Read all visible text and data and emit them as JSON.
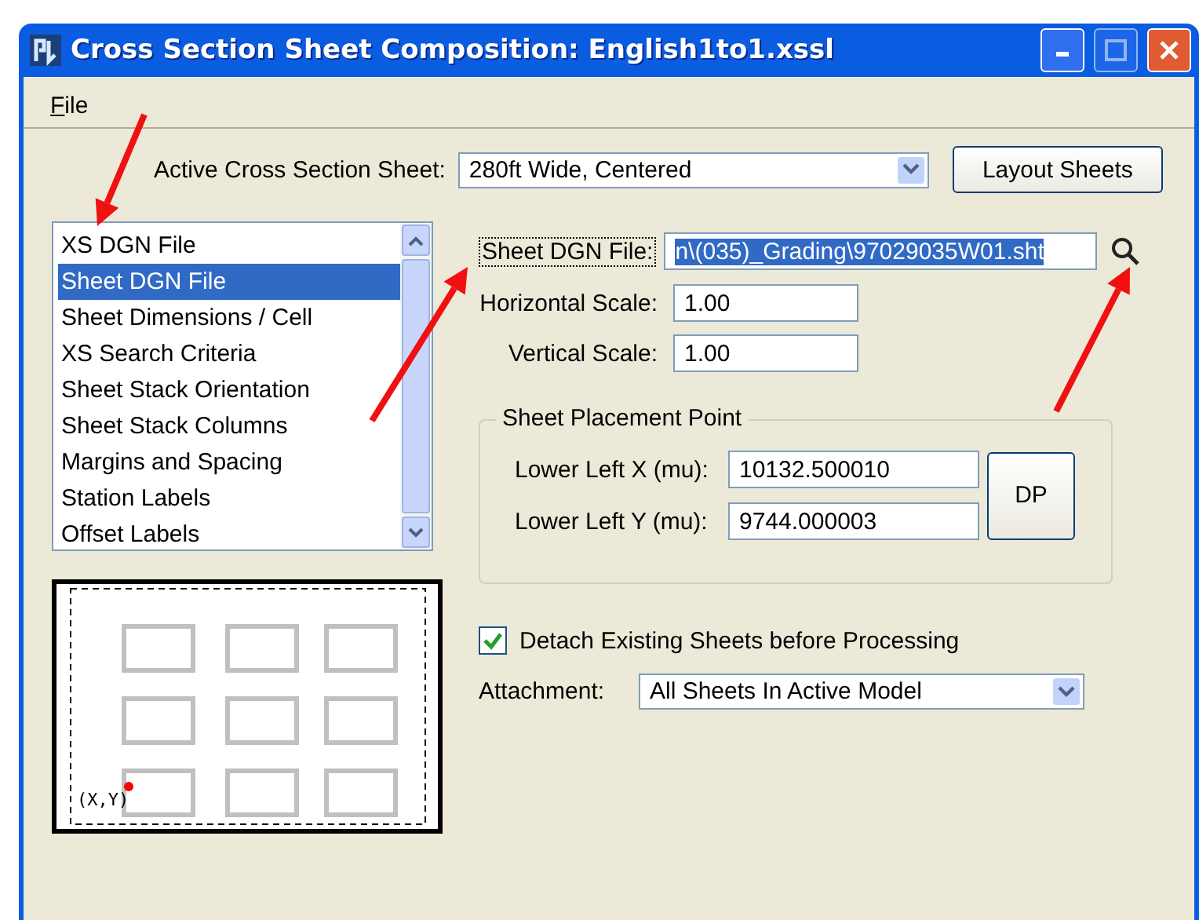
{
  "window": {
    "title": "Cross Section Sheet Composition: English1to1.xssl"
  },
  "menu": [
    {
      "label": "File"
    }
  ],
  "active_sheet": {
    "label": "Active Cross Section Sheet:",
    "value": "280ft Wide, Centered"
  },
  "layout_button": "Layout Sheets",
  "categories": [
    {
      "label": "XS DGN File",
      "selected": false
    },
    {
      "label": "Sheet DGN File",
      "selected": true
    },
    {
      "label": "Sheet Dimensions / Cell",
      "selected": false
    },
    {
      "label": "XS Search Criteria",
      "selected": false
    },
    {
      "label": "Sheet Stack Orientation",
      "selected": false
    },
    {
      "label": "Sheet Stack Columns",
      "selected": false
    },
    {
      "label": "Margins and Spacing",
      "selected": false
    },
    {
      "label": "Station Labels",
      "selected": false
    },
    {
      "label": "Offset Labels",
      "selected": false
    }
  ],
  "sheet_file": {
    "label": "Sheet DGN File:",
    "value": "n\\(035)_Grading\\97029035W01.sht",
    "focused": true
  },
  "horizontal_scale": {
    "label": "Horizontal Scale:",
    "value": "1.00"
  },
  "vertical_scale": {
    "label": "Vertical Scale:",
    "value": "1.00"
  },
  "placement": {
    "title": "Sheet Placement Point",
    "x": {
      "label": "Lower Left X (mu):",
      "value": "10132.500010"
    },
    "y": {
      "label": "Lower Left Y (mu):",
      "value": "9744.000003"
    },
    "button": "DP"
  },
  "preview": {
    "label": "(X,Y)"
  },
  "detach": {
    "label": "Detach Existing Sheets before Processing",
    "checked": true
  },
  "attachment": {
    "label": "Attachment:",
    "value": "All Sheets In Active Model"
  }
}
